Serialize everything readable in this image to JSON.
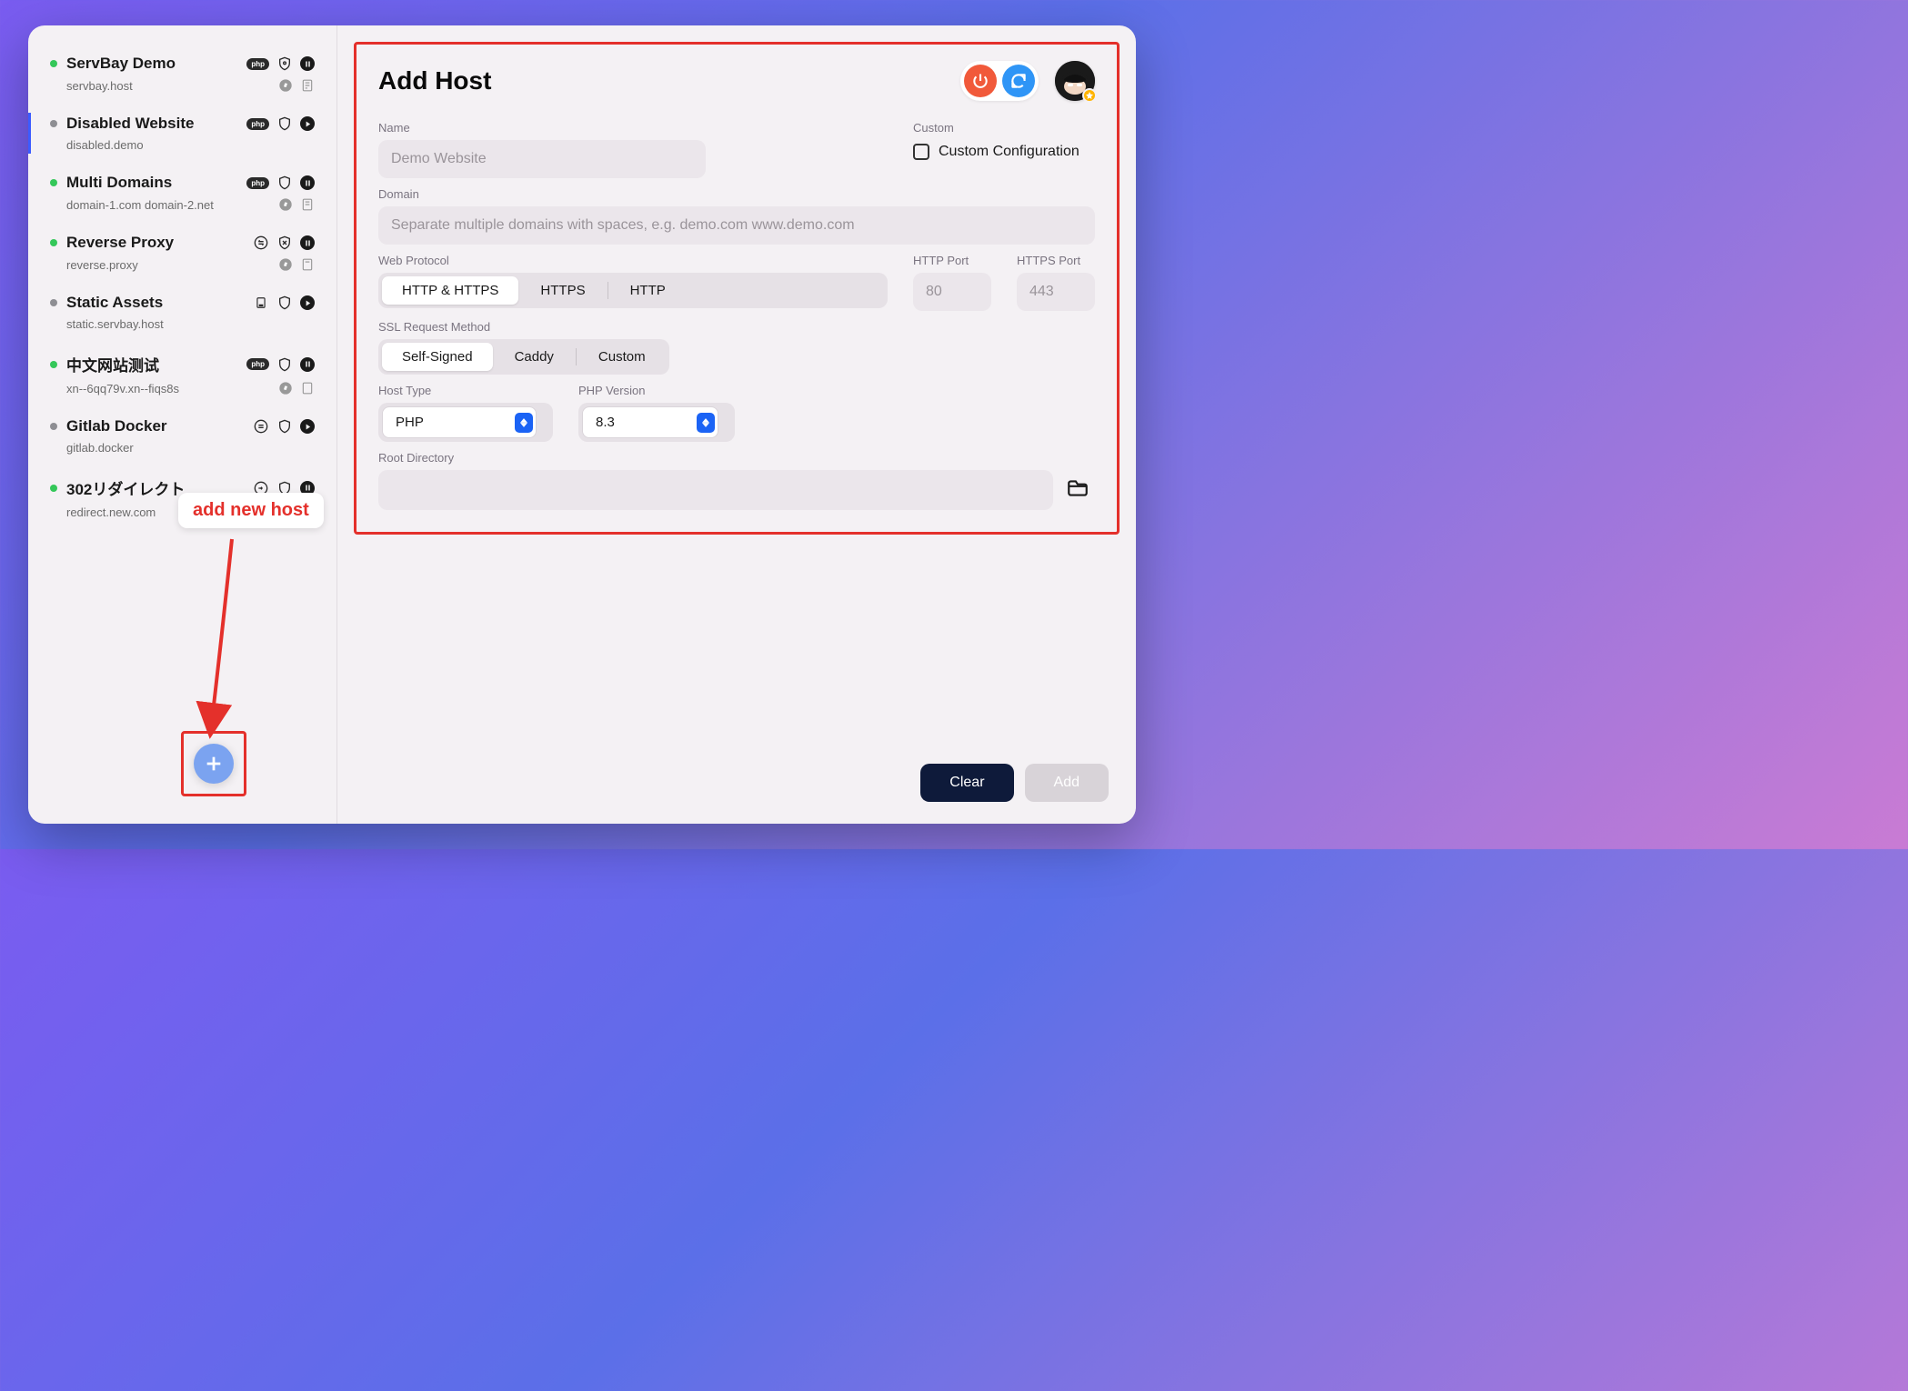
{
  "sidebar": {
    "items": [
      {
        "title": "ServBay Demo",
        "sub": "servbay.host",
        "dot": "green",
        "icon_set": "php_pause"
      },
      {
        "title": "Disabled Website",
        "sub": "disabled.demo",
        "dot": "gray",
        "icon_set": "php_play"
      },
      {
        "title": "Multi Domains",
        "sub": "domain-1.com domain-2.net",
        "dot": "green",
        "icon_set": "php_pause"
      },
      {
        "title": "Reverse Proxy",
        "sub": "reverse.proxy",
        "dot": "green",
        "icon_set": "proxy_pause"
      },
      {
        "title": "Static Assets",
        "sub": "static.servbay.host",
        "dot": "gray",
        "icon_set": "static_play"
      },
      {
        "title": "中文网站测试",
        "sub": "xn--6qq79v.xn--fiqs8s",
        "dot": "green",
        "icon_set": "php_pause"
      },
      {
        "title": "Gitlab Docker",
        "sub": "gitlab.docker",
        "dot": "gray",
        "icon_set": "proxy_play"
      },
      {
        "title": "302リダイレクト",
        "sub": "redirect.new.com",
        "dot": "green",
        "icon_set": "redirect_pause"
      }
    ],
    "selected_index": 1
  },
  "callout": "add new host",
  "header": {
    "title": "Add Host"
  },
  "form": {
    "name_label": "Name",
    "name_placeholder": "Demo Website",
    "custom_label": "Custom",
    "custom_checkbox_label": "Custom Configuration",
    "domain_label": "Domain",
    "domain_placeholder": "Separate multiple domains with spaces, e.g. demo.com www.demo.com",
    "web_protocol_label": "Web Protocol",
    "web_protocol_options": [
      "HTTP & HTTPS",
      "HTTPS",
      "HTTP"
    ],
    "web_protocol_selected": 0,
    "http_port_label": "HTTP Port",
    "http_port_placeholder": "80",
    "https_port_label": "HTTPS Port",
    "https_port_placeholder": "443",
    "ssl_label": "SSL Request Method",
    "ssl_options": [
      "Self-Signed",
      "Caddy",
      "Custom"
    ],
    "ssl_selected": 0,
    "host_type_label": "Host Type",
    "host_type_value": "PHP",
    "php_version_label": "PHP Version",
    "php_version_value": "8.3",
    "root_label": "Root Directory"
  },
  "footer": {
    "clear": "Clear",
    "add": "Add"
  },
  "php_pill_text": "php"
}
